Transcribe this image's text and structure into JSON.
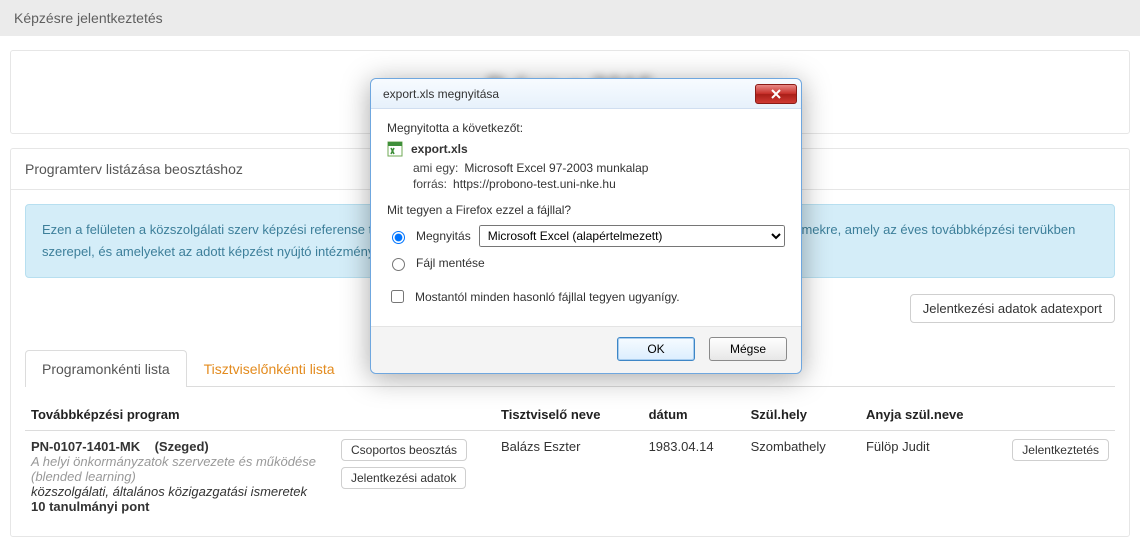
{
  "topbar": {
    "title": "Képzésre jelentkeztetés"
  },
  "header_blur": "P                   éve ●      2015",
  "panel": {
    "title": "Programterv listázása beosztáshoz",
    "info_text": "Ezen a felületen a közszolgálati szerv képzési referense tudja jelentkeztetni a szervnél foglalkoztatott tisztviselőket azon programelemekre, amely az éves továbbképzési tervükben szerepel, és amelyeket az adott képzést nyújtó intézmény meghírdetett.",
    "export_button": "Jelentkezési adatok adatexport"
  },
  "tabs": [
    {
      "label": "Programonkénti lista",
      "active": true
    },
    {
      "label": "Tisztviselőnkénti lista",
      "active": false
    }
  ],
  "table": {
    "headers": {
      "program": "Továbbképzési program",
      "name": "Tisztviselő neve",
      "date": "dátum",
      "birthplace": "Szül.hely",
      "mother": "Anyja szül.neve",
      "actions": ""
    },
    "rows": [
      {
        "code": "PN-0107-1401-MK",
        "city": "(Szeged)",
        "title": "A helyi önkormányzatok szervezete és működése",
        "mode": "(blended learning)",
        "tags": "közszolgálati, általános közigazgatási ismeretek",
        "points": "10 tanulmányi pont",
        "group_button": "Csoportos beosztás",
        "data_button": "Jelentkezési adatok",
        "name": "Balázs Eszter",
        "date": "1983.04.14",
        "birthplace": "Szombathely",
        "mother": "Fülöp Judit",
        "row_button": "Jelentkeztetés"
      }
    ]
  },
  "dialog": {
    "title": "export.xls megnyitása",
    "opened_label": "Megnyitotta a következőt:",
    "filename": "export.xls",
    "type_label": "ami egy:",
    "type_value": "Microsoft Excel 97-2003 munkalap",
    "source_label": "forrás:",
    "source_value": "https://probono-test.uni-nke.hu",
    "question": "Mit tegyen a Firefox ezzel a fájllal?",
    "open_label": "Megnyitás",
    "open_with": "Microsoft Excel (alapértelmezett)",
    "save_label": "Fájl mentése",
    "remember_label": "Mostantól minden hasonló fájllal tegyen ugyanígy.",
    "ok": "OK",
    "cancel": "Mégse"
  }
}
